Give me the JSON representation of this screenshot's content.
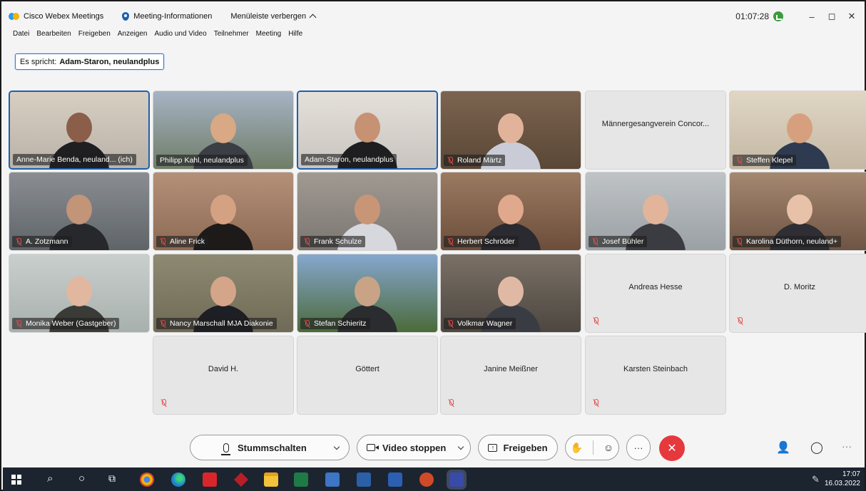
{
  "titlebar": {
    "app_name": "Cisco Webex Meetings",
    "meeting_info": "Meeting-Informationen",
    "hide_menu": "Menüleiste verbergen",
    "timer": "01:07:28",
    "minimize": "–",
    "restore": "◻",
    "close": "✕"
  },
  "menu": [
    "Datei",
    "Bearbeiten",
    "Freigeben",
    "Anzeigen",
    "Audio und Video",
    "Teilnehmer",
    "Meeting",
    "Hilfe"
  ],
  "speaker": {
    "prefix": "Es spricht:",
    "name": "Adam-Staron, neulandplus"
  },
  "participants": [
    {
      "name": "Anne-Marie Benda, neuland... (ich)",
      "video": true,
      "muted": false,
      "active": true
    },
    {
      "name": "Philipp Kahl, neulandplus",
      "video": true,
      "muted": false,
      "active": false
    },
    {
      "name": "Adam-Staron, neulandplus",
      "video": true,
      "muted": false,
      "active": true
    },
    {
      "name": "Roland Märtz",
      "video": true,
      "muted": true,
      "active": false
    },
    {
      "name": "Männergesangverein Concor...",
      "video": false,
      "muted": false,
      "active": false
    },
    {
      "name": "Steffen Klepel",
      "video": true,
      "muted": true,
      "active": false
    },
    {
      "name": "A. Zotzmann",
      "video": true,
      "muted": true,
      "active": false
    },
    {
      "name": "Aline Frick",
      "video": true,
      "muted": true,
      "active": false
    },
    {
      "name": "Frank Schulze",
      "video": true,
      "muted": true,
      "active": false
    },
    {
      "name": "Herbert Schröder",
      "video": true,
      "muted": true,
      "active": false
    },
    {
      "name": "Josef Bühler",
      "video": true,
      "muted": true,
      "active": false
    },
    {
      "name": "Karolina Düthorn, neuland+",
      "video": true,
      "muted": true,
      "active": false
    },
    {
      "name": "Monika Weber (Gastgeber)",
      "video": true,
      "muted": true,
      "active": false
    },
    {
      "name": "Nancy Marschall MJA Diakonie",
      "video": true,
      "muted": true,
      "active": false
    },
    {
      "name": "Stefan Schieritz",
      "video": true,
      "muted": true,
      "active": false
    },
    {
      "name": "Volkmar Wagner",
      "video": true,
      "muted": true,
      "active": false
    },
    {
      "name": "Andreas Hesse",
      "video": false,
      "muted": true,
      "active": false
    },
    {
      "name": "D. Moritz",
      "video": false,
      "muted": true,
      "active": false
    },
    {
      "name": "David H.",
      "video": false,
      "muted": true,
      "active": false
    },
    {
      "name": "Göttert",
      "video": false,
      "muted": false,
      "active": false
    },
    {
      "name": "Janine Meißner",
      "video": false,
      "muted": true,
      "active": false
    },
    {
      "name": "Karsten Steinbach",
      "video": false,
      "muted": true,
      "active": false
    }
  ],
  "toolbar": {
    "mute_label": "Stummschalten",
    "video_label": "Video stoppen",
    "share_label": "Freigeben",
    "more_label": "···",
    "end_label": "✕"
  },
  "taskbar": {
    "time": "17:07",
    "date": "16.03.2022"
  }
}
